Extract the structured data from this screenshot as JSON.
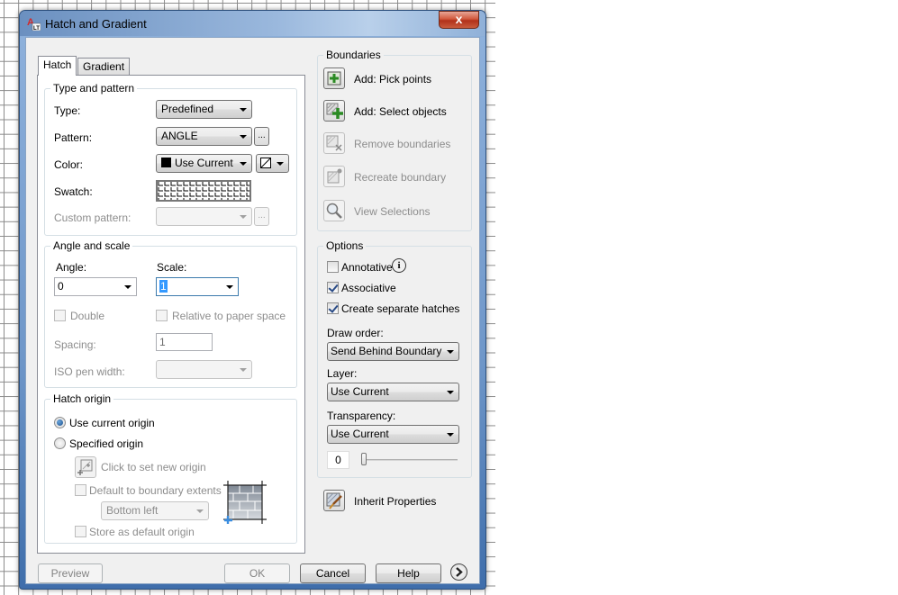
{
  "window": {
    "title": "Hatch and Gradient",
    "close_label": "x",
    "app_icon": "autocad-lt-icon"
  },
  "tabs": [
    {
      "label": "Hatch",
      "active": true
    },
    {
      "label": "Gradient",
      "active": false
    }
  ],
  "type_and_pattern": {
    "title": "Type and pattern",
    "type_label": "Type:",
    "type_value": "Predefined",
    "pattern_label": "Pattern:",
    "pattern_value": "ANGLE",
    "pattern_browse": "...",
    "color_label": "Color:",
    "color_value": "Use Current",
    "color_swatch": "#000000",
    "swatch_label": "Swatch:",
    "custom_pattern_label": "Custom pattern:",
    "custom_pattern_value": "",
    "custom_browse": "..."
  },
  "angle_and_scale": {
    "title": "Angle and scale",
    "angle_label": "Angle:",
    "angle_value": "0",
    "scale_label": "Scale:",
    "scale_value": "1",
    "double_label": "Double",
    "double_checked": false,
    "relative_label": "Relative to paper space",
    "relative_checked": false,
    "spacing_label": "Spacing:",
    "spacing_value": "1",
    "iso_label": "ISO pen width:",
    "iso_value": ""
  },
  "hatch_origin": {
    "title": "Hatch origin",
    "use_current_label": "Use current origin",
    "use_current_selected": true,
    "specified_label": "Specified origin",
    "specified_selected": false,
    "click_set_label": "Click to set new origin",
    "default_extents_label": "Default to boundary extents",
    "default_extents_checked": false,
    "extents_value": "Bottom left",
    "store_default_label": "Store as default origin",
    "store_default_checked": false
  },
  "boundaries": {
    "title": "Boundaries",
    "items": [
      {
        "label": "Add: Pick points",
        "enabled": true,
        "icon": "pick-points-icon"
      },
      {
        "label": "Add: Select objects",
        "enabled": true,
        "icon": "select-objects-icon"
      },
      {
        "label": "Remove boundaries",
        "enabled": false,
        "icon": "remove-boundaries-icon"
      },
      {
        "label": "Recreate boundary",
        "enabled": false,
        "icon": "recreate-boundary-icon"
      },
      {
        "label": "View Selections",
        "enabled": false,
        "icon": "magnifier-icon"
      }
    ]
  },
  "options": {
    "title": "Options",
    "annotative_label": "Annotative",
    "annotative_checked": false,
    "associative_label": "Associative",
    "associative_checked": true,
    "separate_label": "Create separate hatches",
    "separate_checked": true,
    "draw_order_label": "Draw order:",
    "draw_order_value": "Send Behind Boundary",
    "layer_label": "Layer:",
    "layer_value": "Use Current",
    "transparency_label": "Transparency:",
    "transparency_value": "Use Current",
    "transparency_amount": "0",
    "transparency_slider_percent": 0
  },
  "inherit": {
    "label": "Inherit Properties"
  },
  "footer": {
    "preview": "Preview",
    "ok": "OK",
    "cancel": "Cancel",
    "help": "Help",
    "more": "more-options"
  }
}
